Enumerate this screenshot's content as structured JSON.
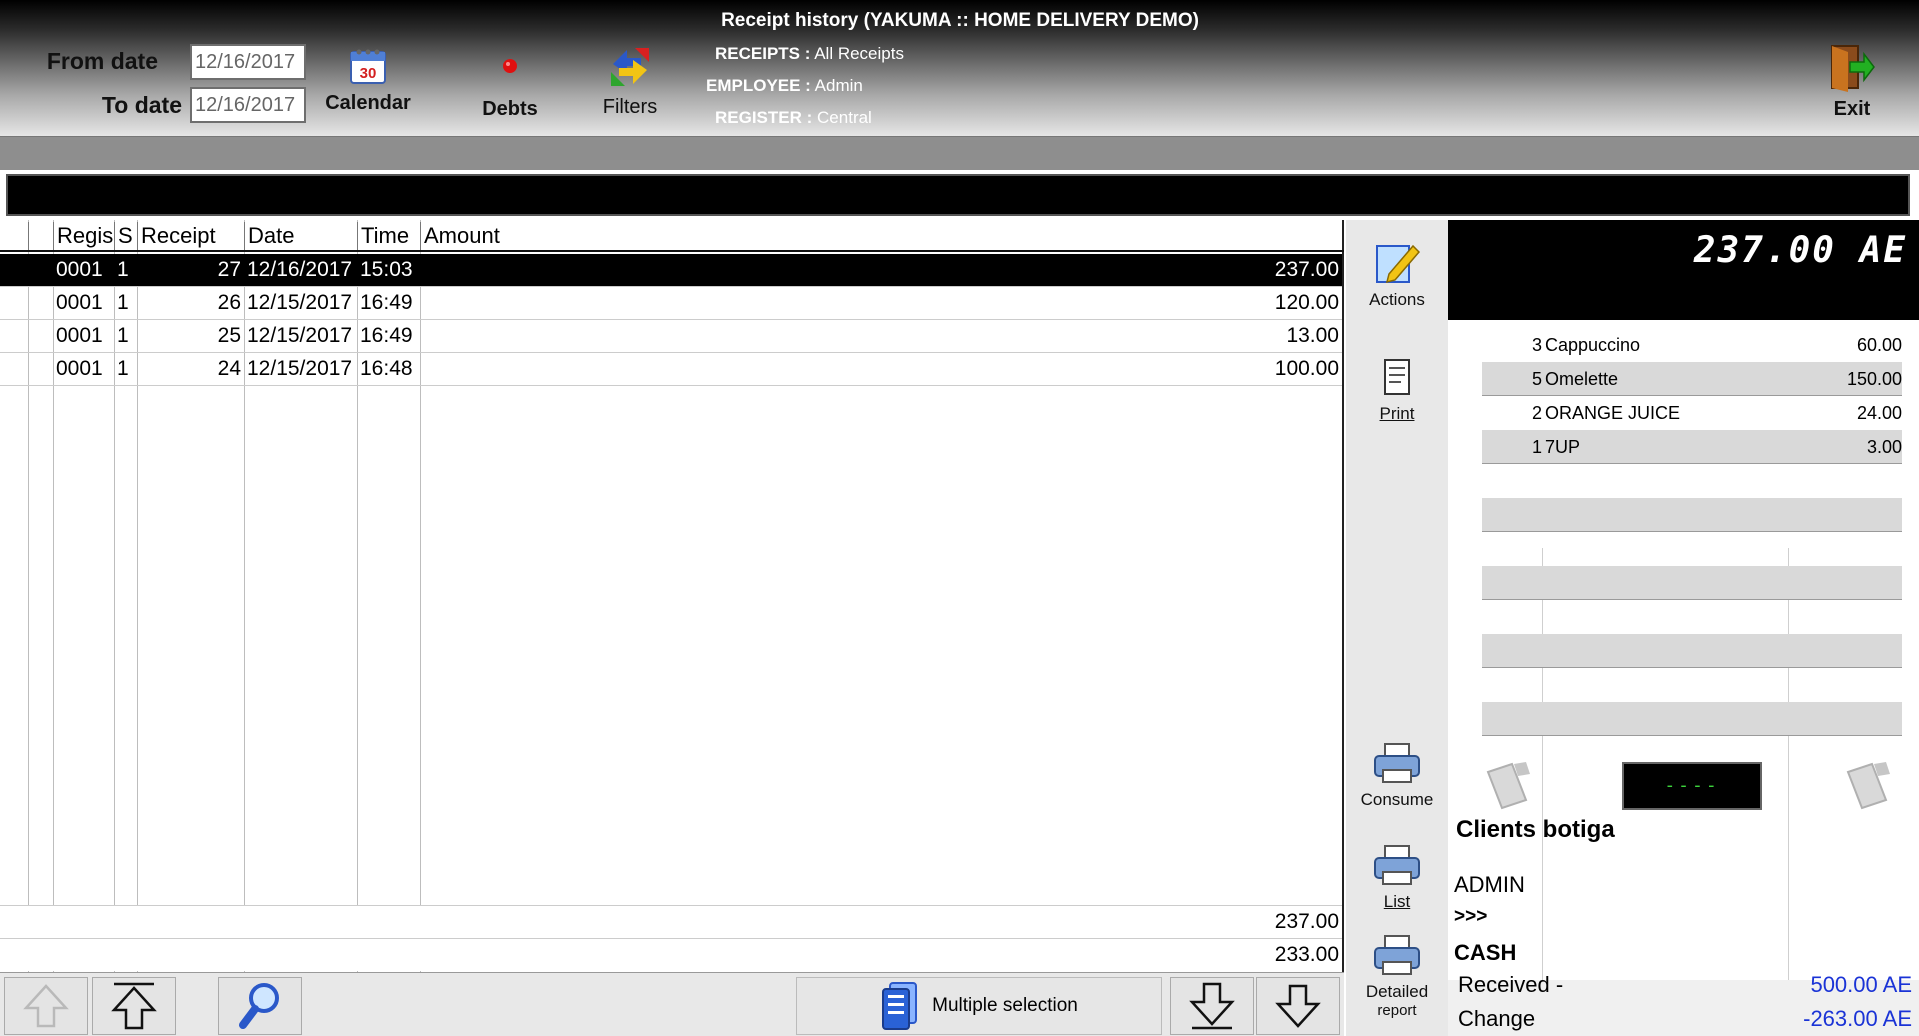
{
  "header": {
    "title": "Receipt history  (YAKUMA :: HOME DELIVERY DEMO)",
    "from_label": "From date",
    "from_value": "12/16/2017",
    "to_label": "To  date",
    "to_value": "12/16/2017",
    "tools": {
      "calendar": "Calendar",
      "debts": "Debts",
      "filters": "Filters",
      "exit": "Exit"
    },
    "info": {
      "receipts_label": "RECEIPTS :",
      "receipts_value": "All Receipts",
      "employee_label": "EMPLOYEE :",
      "employee_value": "Admin",
      "register_label": "REGISTER :",
      "register_value": "Central"
    }
  },
  "table": {
    "columns": [
      "Regis",
      "S",
      "Receipt",
      "Date",
      "Time",
      "Amount"
    ],
    "rows": [
      {
        "register": "0001",
        "s": "1",
        "receipt": "27",
        "date": "12/16/2017",
        "time": "15:03",
        "amount": "237.00"
      },
      {
        "register": "0001",
        "s": "1",
        "receipt": "26",
        "date": "12/15/2017",
        "time": "16:49",
        "amount": "120.00"
      },
      {
        "register": "0001",
        "s": "1",
        "receipt": "25",
        "date": "12/15/2017",
        "time": "16:49",
        "amount": "13.00"
      },
      {
        "register": "0001",
        "s": "1",
        "receipt": "24",
        "date": "12/15/2017",
        "time": "16:48",
        "amount": "100.00"
      }
    ],
    "selected_index": 0,
    "total_1": "237.00",
    "total_2": "233.00"
  },
  "bottom": {
    "multi_selection": "Multiple selection"
  },
  "side": {
    "actions": "Actions",
    "print": "Print",
    "consume": "Consume",
    "list": "List",
    "detailed_report_1": "Detailed",
    "detailed_report_2": "report"
  },
  "panel": {
    "total": "237.00 AE",
    "items": [
      {
        "qty": "3",
        "name": "Cappuccino",
        "price": "60.00"
      },
      {
        "qty": "5",
        "name": "Omelette",
        "price": "150.00"
      },
      {
        "qty": "2",
        "name": "ORANGE JUICE",
        "price": "24.00"
      },
      {
        "qty": "1",
        "name": "7UP",
        "price": "3.00"
      }
    ],
    "lcd": "----",
    "client_name": "Clients botiga",
    "client_user": "ADMIN",
    "client_more": ">>>",
    "pay_method": "CASH",
    "received_label": "Received -",
    "received_value": "500.00 AE",
    "change_label": "Change",
    "change_value": "-263.00 AE"
  }
}
